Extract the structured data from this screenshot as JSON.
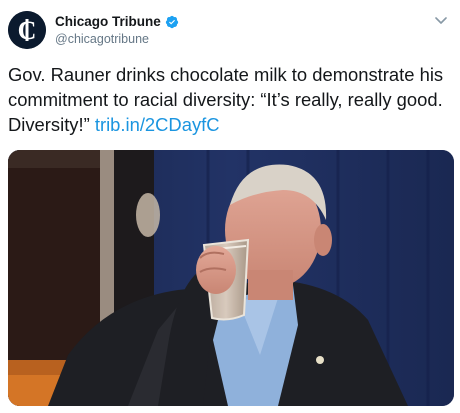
{
  "account": {
    "display_name": "Chicago Tribune",
    "handle": "@chicagotribune",
    "verified": true,
    "avatar_icon": "chicago-tribune-logo-icon"
  },
  "tweet": {
    "text": "Gov. Rauner drinks chocolate milk to demonstrate his commitment to racial diversity: “It’s really, really good. Diversity!” ",
    "link_text": "trib.in/2CDayfC"
  },
  "media": {
    "alt": "Photo of a man in a dark suit and light blue shirt drinking a glass of chocolate milk in front of a dark blue curtain",
    "type": "photo"
  },
  "colors": {
    "link": "#1b95e0",
    "verified": "#1da1f2",
    "text": "#14171a",
    "secondary": "#657786"
  }
}
